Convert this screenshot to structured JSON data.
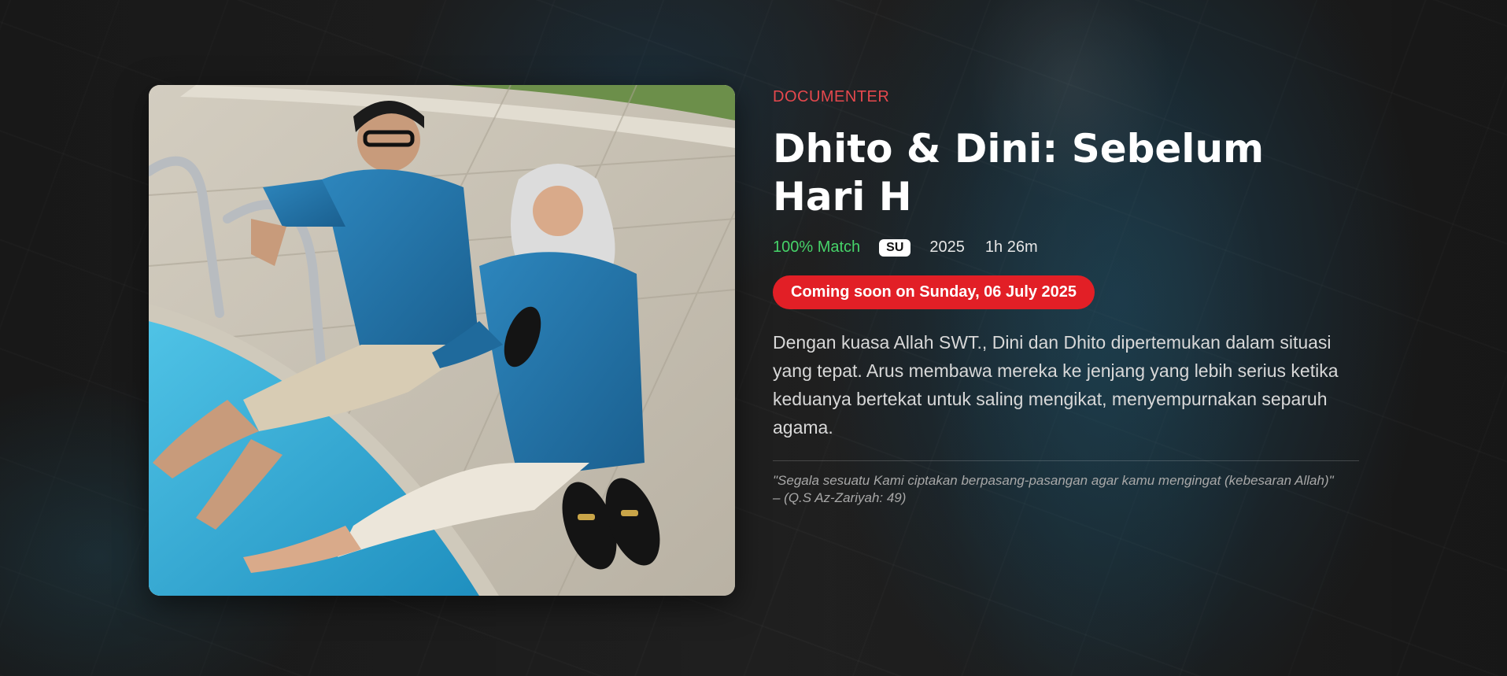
{
  "background": {
    "accent_color": "#e21f26",
    "match_color": "#46d369",
    "category_color": "#e5484d"
  },
  "poster": {
    "alt": "Dhito & Dini couple photo"
  },
  "info": {
    "category": "DOCUMENTER",
    "title": "Dhito & Dini: Sebelum Hari H",
    "match": "100% Match",
    "rating": "SU",
    "year": "2025",
    "duration": "1h 26m",
    "coming_soon": "Coming soon on Sunday, 06 July 2025",
    "description": "Dengan kuasa Allah SWT., Dini dan Dhito dipertemukan dalam situasi yang tepat. Arus membawa mereka ke jenjang yang lebih serius ketika keduanya bertekat untuk saling mengikat, menyempurnakan separuh agama.",
    "quote_text": "\"Segala sesuatu Kami ciptakan berpasang-pasangan agar kamu mengingat (kebesaran Allah)\"",
    "quote_source": "– (Q.S Az-Zariyah: 49)"
  }
}
